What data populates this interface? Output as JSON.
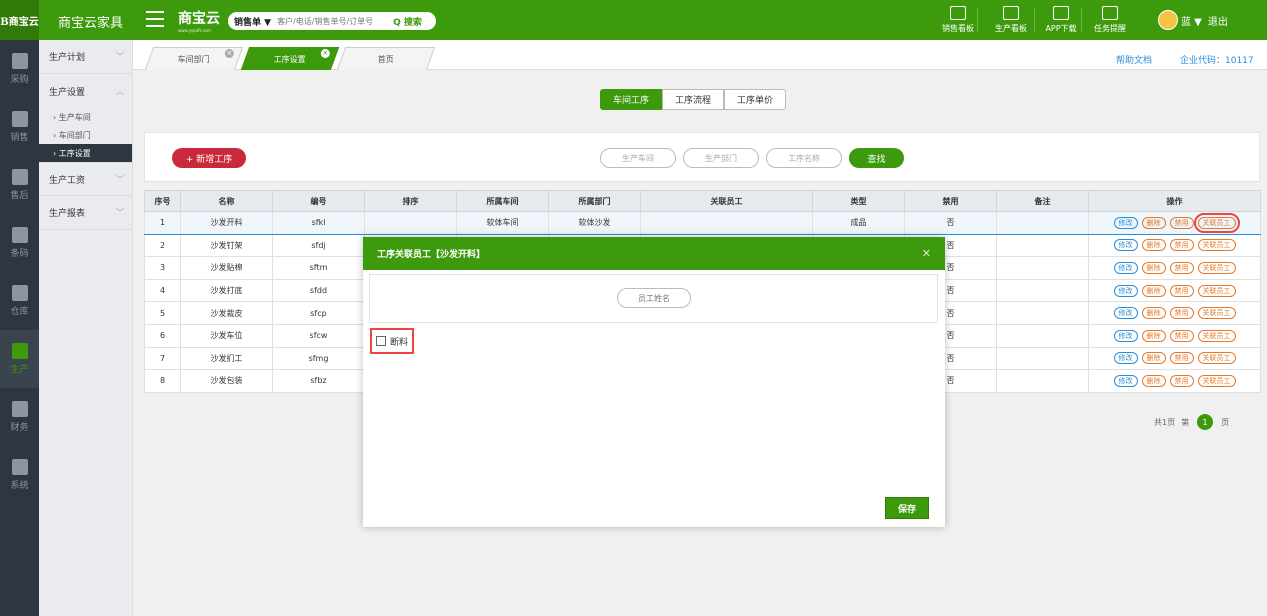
{
  "app": {
    "logo_text": "B商宝云",
    "title": "商宝云家具",
    "brand": "商宝云",
    "brand_sub": "www.yqsoft.com"
  },
  "search": {
    "type_label": "销售单 ▼",
    "placeholder": "客户/电话/销售单号/订单号",
    "button": "Q 搜索"
  },
  "top_nav": [
    {
      "label": "销售看板",
      "icon": "chart-board-icon"
    },
    {
      "label": "生产看板",
      "icon": "production-board-icon"
    },
    {
      "label": "APP下载",
      "icon": "qrcode-icon"
    },
    {
      "label": "任务提醒",
      "icon": "flag-icon"
    }
  ],
  "user": {
    "name": "蓝 ▼",
    "logout": "退出"
  },
  "rail": [
    {
      "label": "采购",
      "icon": "cart-icon"
    },
    {
      "label": "销售",
      "icon": "sales-icon"
    },
    {
      "label": "售后",
      "icon": "after-sale-icon"
    },
    {
      "label": "条码",
      "icon": "barcode-icon"
    },
    {
      "label": "仓库",
      "icon": "warehouse-icon"
    },
    {
      "label": "生产",
      "icon": "production-icon"
    },
    {
      "label": "财务",
      "icon": "calculator-icon"
    },
    {
      "label": "系统",
      "icon": "gear-icon"
    }
  ],
  "sidebar": {
    "groups": [
      {
        "label": "生产计划",
        "arrow": "﹀"
      },
      {
        "label": "生产设置",
        "arrow": "︿"
      },
      {
        "label": "生产工资",
        "arrow": "﹀"
      },
      {
        "label": "生产报表",
        "arrow": "﹀"
      }
    ],
    "children": [
      "› 生产车间",
      "› 车间部门",
      "› 工序设置"
    ]
  },
  "tabs": [
    {
      "label": "车间部门"
    },
    {
      "label": "工序设置"
    },
    {
      "label": "首页"
    }
  ],
  "header_links": {
    "help": "帮助文档",
    "corp_code": "企业代码：10117"
  },
  "segments": [
    "车间工序",
    "工序流程",
    "工序单价"
  ],
  "toolbar": {
    "add_button": "+ 新增工序",
    "filter_workshop": "生产车间",
    "filter_dept": "生产部门",
    "filter_name": "工序名称",
    "find_button": "查找"
  },
  "table": {
    "headers": [
      "序号",
      "名称",
      "编号",
      "排序",
      "所属车间",
      "所属部门",
      "关联员工",
      "类型",
      "禁用",
      "备注",
      "操作"
    ],
    "rows": [
      {
        "no": "1",
        "name": "沙发开料",
        "code": "sfkl",
        "sort": "",
        "workshop": "软体车间",
        "dept": "软体沙发",
        "staff": "",
        "type": "成品",
        "disabled": "否",
        "remark": ""
      },
      {
        "no": "2",
        "name": "沙发钉架",
        "code": "sfdj",
        "sort": "",
        "workshop": "",
        "dept": "",
        "staff": "",
        "type": "",
        "disabled": "否",
        "remark": ""
      },
      {
        "no": "3",
        "name": "沙发贴棉",
        "code": "sftm",
        "sort": "",
        "workshop": "",
        "dept": "",
        "staff": "",
        "type": "",
        "disabled": "否",
        "remark": ""
      },
      {
        "no": "4",
        "name": "沙发打底",
        "code": "sfdd",
        "sort": "",
        "workshop": "",
        "dept": "",
        "staff": "",
        "type": "",
        "disabled": "否",
        "remark": ""
      },
      {
        "no": "5",
        "name": "沙发裁皮",
        "code": "sfcp",
        "sort": "",
        "workshop": "",
        "dept": "",
        "staff": "",
        "type": "",
        "disabled": "否",
        "remark": ""
      },
      {
        "no": "6",
        "name": "沙发车位",
        "code": "sfcw",
        "sort": "",
        "workshop": "",
        "dept": "",
        "staff": "",
        "type": "",
        "disabled": "否",
        "remark": ""
      },
      {
        "no": "7",
        "name": "沙发扪工",
        "code": "sfmg",
        "sort": "",
        "workshop": "",
        "dept": "",
        "staff": "",
        "type": "",
        "disabled": "否",
        "remark": ""
      },
      {
        "no": "8",
        "name": "沙发包装",
        "code": "sfbz",
        "sort": "",
        "workshop": "",
        "dept": "",
        "staff": "",
        "type": "",
        "disabled": "否",
        "remark": ""
      }
    ],
    "ops": [
      "修改",
      "删除",
      "禁用",
      "关联员工"
    ]
  },
  "pager": {
    "total": "共1页",
    "prefix": "第",
    "current": "1",
    "suffix": "页"
  },
  "modal": {
    "title": "工序关联员工【沙发开料】",
    "close": "✕",
    "search_placeholder": "员工姓名",
    "checkbox_label": "断料",
    "save": "保存"
  },
  "colors": {
    "brand_green": "#3d9a0c",
    "rail_bg": "#2e3640",
    "add_red": "#c9293a",
    "link_blue": "#2a8fd8",
    "op_orange": "#e57a2a",
    "highlight_red": "#ee4444"
  }
}
